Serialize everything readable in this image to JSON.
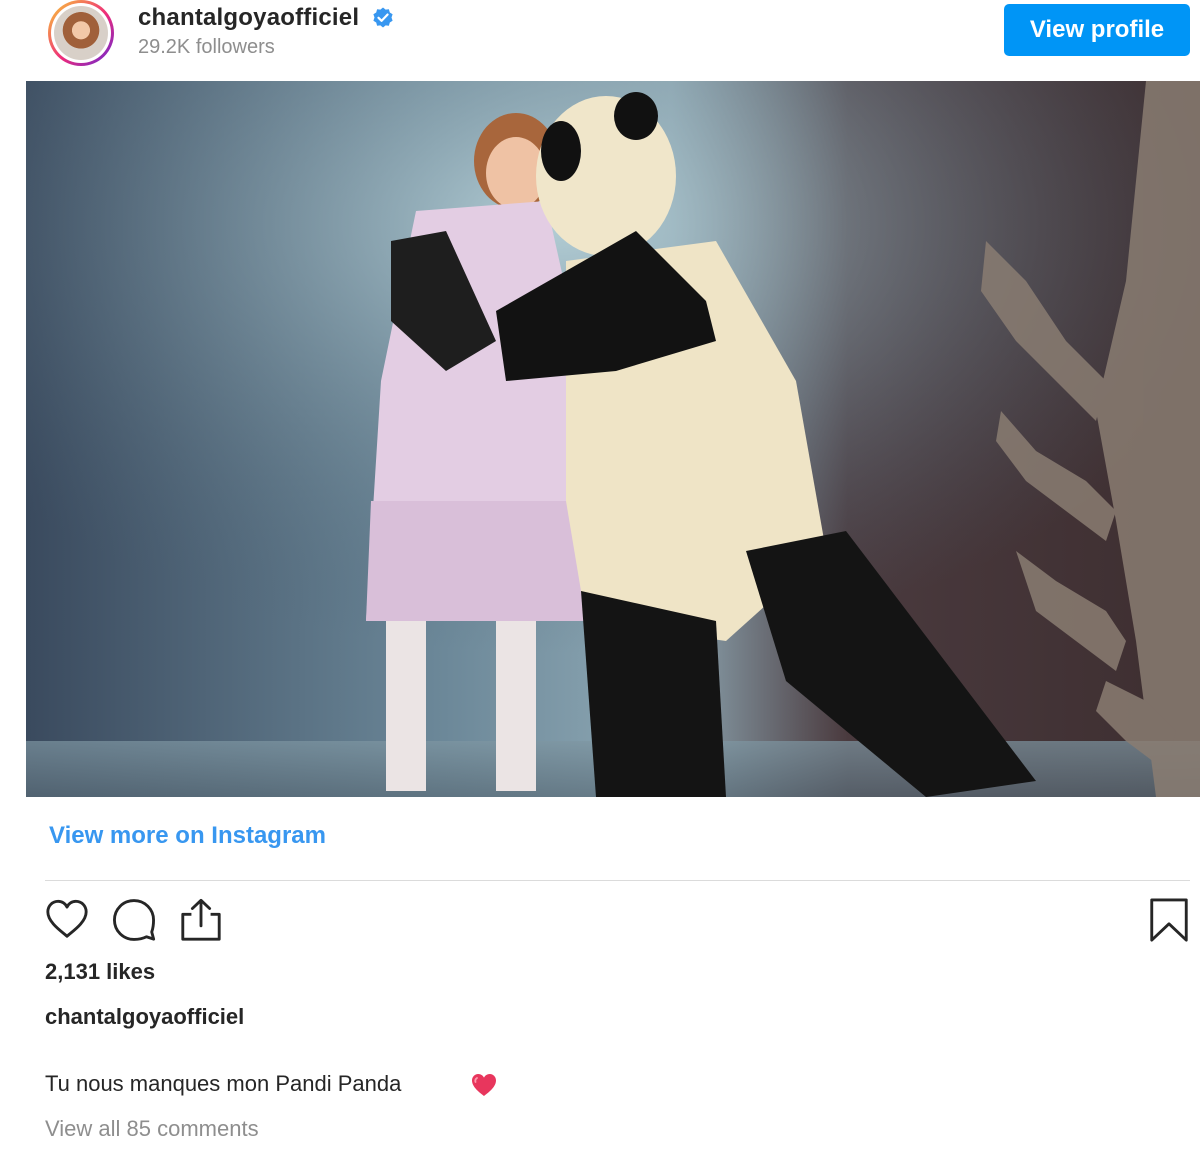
{
  "header": {
    "username": "chantalgoyaofficiel",
    "verified": true,
    "followers": "29.2K followers",
    "view_profile_label": "View profile",
    "accent_color": "#0095f6"
  },
  "post": {
    "image_alt_description": "",
    "view_more_label": "View more on Instagram",
    "link_color": "#3897f0"
  },
  "actions": {
    "icons": [
      "heart-icon",
      "comment-icon",
      "share-icon",
      "bookmark-icon"
    ]
  },
  "stats": {
    "likes": "2,131 likes"
  },
  "caption": {
    "username": "chantalgoyaofficiel",
    "text": "Tu nous manques mon Pandi Panda",
    "emoji": "heart-emoji"
  },
  "comments": {
    "view_all_label": "View all 85 comments"
  }
}
